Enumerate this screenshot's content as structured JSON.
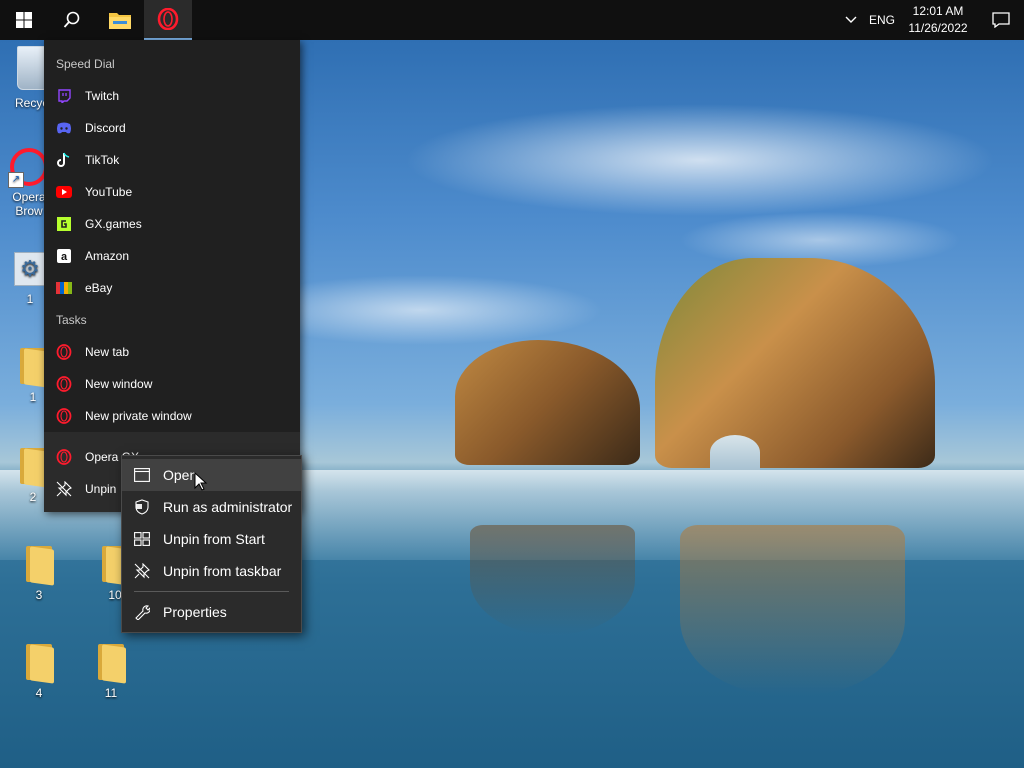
{
  "taskbar": {
    "clock": {
      "time": "12:01 AM",
      "date": "11/26/2022"
    },
    "language": "ENG"
  },
  "desktop_icons": [
    {
      "label": "Recycl",
      "kind": "recycle"
    },
    {
      "label": "Opera Brow",
      "kind": "opera"
    },
    {
      "label": "1",
      "kind": "settings"
    },
    {
      "label": "1",
      "kind": "folder"
    },
    {
      "label": "2",
      "kind": "folder"
    },
    {
      "label": "3",
      "kind": "folder"
    },
    {
      "label": "10",
      "kind": "folder"
    },
    {
      "label": "4",
      "kind": "folder"
    },
    {
      "label": "11",
      "kind": "folder"
    }
  ],
  "jumplist": {
    "speed_dial_header": "Speed Dial",
    "speed_dial": [
      {
        "label": "Twitch",
        "color": "#9146ff"
      },
      {
        "label": "Discord",
        "color": "#5865f2"
      },
      {
        "label": "TikTok",
        "color": "#ffffff"
      },
      {
        "label": "YouTube",
        "color": "#ff0000"
      },
      {
        "label": "GX.games",
        "color": "#b6ff2e"
      },
      {
        "label": "Amazon",
        "color": "#ffffff"
      },
      {
        "label": "eBay",
        "color": "#e53238"
      }
    ],
    "tasks_header": "Tasks",
    "tasks": [
      {
        "label": "New tab"
      },
      {
        "label": "New window"
      },
      {
        "label": "New private window"
      }
    ],
    "pinned": [
      {
        "label": "Opera GX"
      },
      {
        "label": "Unpin"
      }
    ]
  },
  "context_menu": {
    "items": [
      {
        "label": "Open",
        "icon": "window-icon"
      },
      {
        "label": "Run as administrator",
        "icon": "shield-icon"
      },
      {
        "label": "Unpin from Start",
        "icon": "unpin-start-icon"
      },
      {
        "label": "Unpin from taskbar",
        "icon": "unpin-taskbar-icon"
      },
      {
        "label": "Properties",
        "icon": "wrench-icon"
      }
    ]
  },
  "colors": {
    "opera_red": "#ff1b2d",
    "accent_blue": "#7eb4ea"
  }
}
